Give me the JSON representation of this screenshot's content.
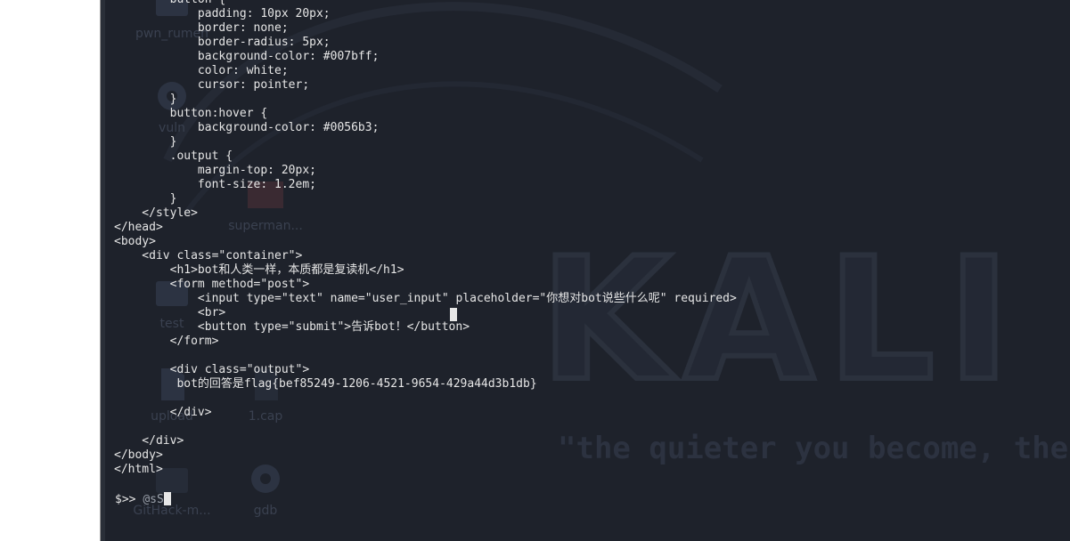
{
  "terminal": {
    "code_lines": [
      "        button {",
      "            padding: 10px 20px;",
      "            border: none;",
      "            border-radius: 5px;",
      "            background-color: #007bff;",
      "            color: white;",
      "            cursor: pointer;",
      "        }",
      "        button:hover {",
      "            background-color: #0056b3;",
      "        }",
      "        .output {",
      "            margin-top: 20px;",
      "            font-size: 1.2em;",
      "        }",
      "    </style>",
      "</head>",
      "<body>",
      "    <div class=\"container\">",
      "        <h1>bot和人类一样，本质都是复读机</h1>",
      "        <form method=\"post\">",
      "            <input type=\"text\" name=\"user_input\" placeholder=\"你想对bot说些什么呢\" required>",
      "            <br>",
      "            <button type=\"submit\">告诉bot！</button>",
      "        </form>",
      "",
      "        <div class=\"output\">",
      "         bot的回答是flag{bef85249-1206-4521-9654-429a44d3b1db}",
      "",
      "        </div>",
      "",
      "    </div>",
      "</body>",
      "</html>"
    ],
    "prompt_symbol": "$>>",
    "prompt_input": "@sS"
  },
  "desktop": {
    "icons": [
      {
        "name": "pwn_rumen",
        "label": "pwn_rumen"
      },
      {
        "name": "vuln",
        "label": "vuln"
      },
      {
        "name": "superman",
        "label": "superman..."
      },
      {
        "name": "test",
        "label": "test"
      },
      {
        "name": "upload",
        "label": "upload"
      },
      {
        "name": "1cap",
        "label": "1.cap"
      },
      {
        "name": "githack",
        "label": "GitHack-m..."
      },
      {
        "name": "gdb",
        "label": "gdb"
      }
    ],
    "logo_text": "KALI L",
    "slogan": "\"the quieter you become, the"
  },
  "colors": {
    "terminal_bg": "#1e222b",
    "text": "#e6e6e6",
    "prompt_user": "#9aa0aa"
  }
}
